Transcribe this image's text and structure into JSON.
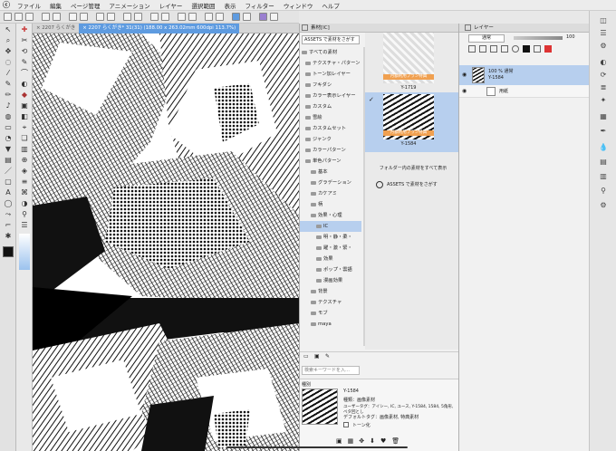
{
  "menu": {
    "logo_glyph": "ⓒ",
    "items": [
      "ファイル",
      "編集",
      "ページ管理",
      "アニメーション",
      "レイヤー",
      "選択範囲",
      "表示",
      "フィルター",
      "ウィンドウ",
      "ヘルプ"
    ]
  },
  "tabs": [
    {
      "label": "× 2207 らくがき"
    },
    {
      "label": "× 2207 らくがき* 31(31) (188.00 x 263.02mm 600dpi 113.7%)"
    }
  ],
  "material_panel": {
    "tab_label": "素材[IC]",
    "assets_button": "ASSETS で素材をさがす",
    "tree": [
      "すべての素材",
      "テクスチャ・パターン",
      "トーン加レイヤー",
      "フキダシ",
      "カラー表示レイヤー",
      "カスタム",
      "雪絵",
      "カスタムセット",
      "ジャンク",
      "カラーパターン",
      "単色パターン",
      "基本",
      "グラデーション",
      "カケアミ",
      "柄",
      "効果・心理",
      "IC",
      "明・静・柔・",
      "躍・激・緊・",
      "効果",
      "ポップ・雲語",
      "漫画効果",
      "背景",
      "テクスチャ",
      "モブ",
      "maya"
    ],
    "selected_tree_item": "IC",
    "thumbnails": [
      {
        "badge": "月額利用プラン特典",
        "id": "Y-1719"
      },
      {
        "badge": "月額利用プラン特典",
        "id": "Y-1584"
      }
    ],
    "show_all_label": "フォルダー内の素材をすべて表示",
    "assets_search_label": "ASSETS で素材をさがす",
    "search_placeholder": "検索キーワードを入…",
    "info": {
      "section_label": "種別",
      "id": "Y-1584",
      "kind": "種類：画像素材",
      "user_tags": "ユーザータグ：アイシー, IC, ユース, Y-1584, 1584, 5角形, ベタ回とし",
      "default_tags": "デフォルトタグ：画像素材, 特典素材",
      "tone_label": "トーン化"
    }
  },
  "layer_panel": {
    "tab_label": "レイヤー",
    "blend_mode": "通常",
    "opacity": "100",
    "layers": [
      {
        "line1": "100 % 通常",
        "line2": "Y-1584",
        "selected": true
      },
      {
        "line1": "用紙",
        "line2": "",
        "selected": false
      }
    ]
  },
  "colors": {
    "accent": "#5e9be0",
    "selection": "#b7cfee",
    "badge": "#f0a050"
  }
}
